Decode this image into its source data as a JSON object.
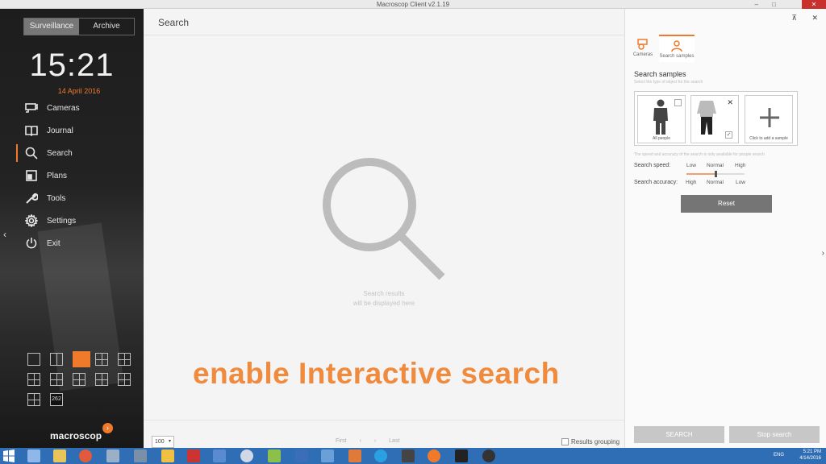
{
  "window": {
    "title": "Macroscop Client v2.1.19"
  },
  "sidebar": {
    "mode_tabs": [
      "Surveillance",
      "Archive"
    ],
    "clock": "15:21",
    "date": "14 April 2016",
    "nav": [
      {
        "label": "Cameras",
        "icon": "camera-icon"
      },
      {
        "label": "Journal",
        "icon": "book-icon"
      },
      {
        "label": "Search",
        "icon": "search-icon",
        "active": true
      },
      {
        "label": "Plans",
        "icon": "plan-icon"
      },
      {
        "label": "Tools",
        "icon": "wrench-icon"
      },
      {
        "label": "Settings",
        "icon": "gear-icon"
      },
      {
        "label": "Exit",
        "icon": "power-icon"
      }
    ],
    "layout_count_label": "262",
    "brand": "macroscop"
  },
  "main": {
    "title": "Search",
    "empty_line1": "Search results",
    "empty_line2": "will be displayed here",
    "overlay": "enable Interactive search",
    "page_size": "100",
    "pager": {
      "first": "First",
      "last": "Last"
    },
    "grouping_label": "Results grouping"
  },
  "panel": {
    "tabs": [
      "Cameras",
      "Search samples"
    ],
    "section_title": "Search samples",
    "section_sub": "Select the type of object for the search",
    "samples": [
      {
        "caption": "All people"
      },
      {
        "caption": ""
      },
      {
        "caption": "Click to add a sample"
      }
    ],
    "note": "The speed and accuracy of the search is only available for people search",
    "speed_label": "Search speed:",
    "speed_levels": [
      "Low",
      "Normal",
      "High"
    ],
    "accuracy_label": "Search accuracy:",
    "accuracy_levels": [
      "High",
      "Normal",
      "Low"
    ],
    "slider_value": 0.5,
    "reset_label": "Reset",
    "search_label": "SEARCH",
    "stop_label": "Stop search"
  },
  "taskbar": {
    "time": "5:21 PM",
    "date": "4/14/2016",
    "lang": "ENG"
  },
  "colors": {
    "accent": "#f07a2c",
    "sidebar_bg": "#1c1c1c"
  }
}
